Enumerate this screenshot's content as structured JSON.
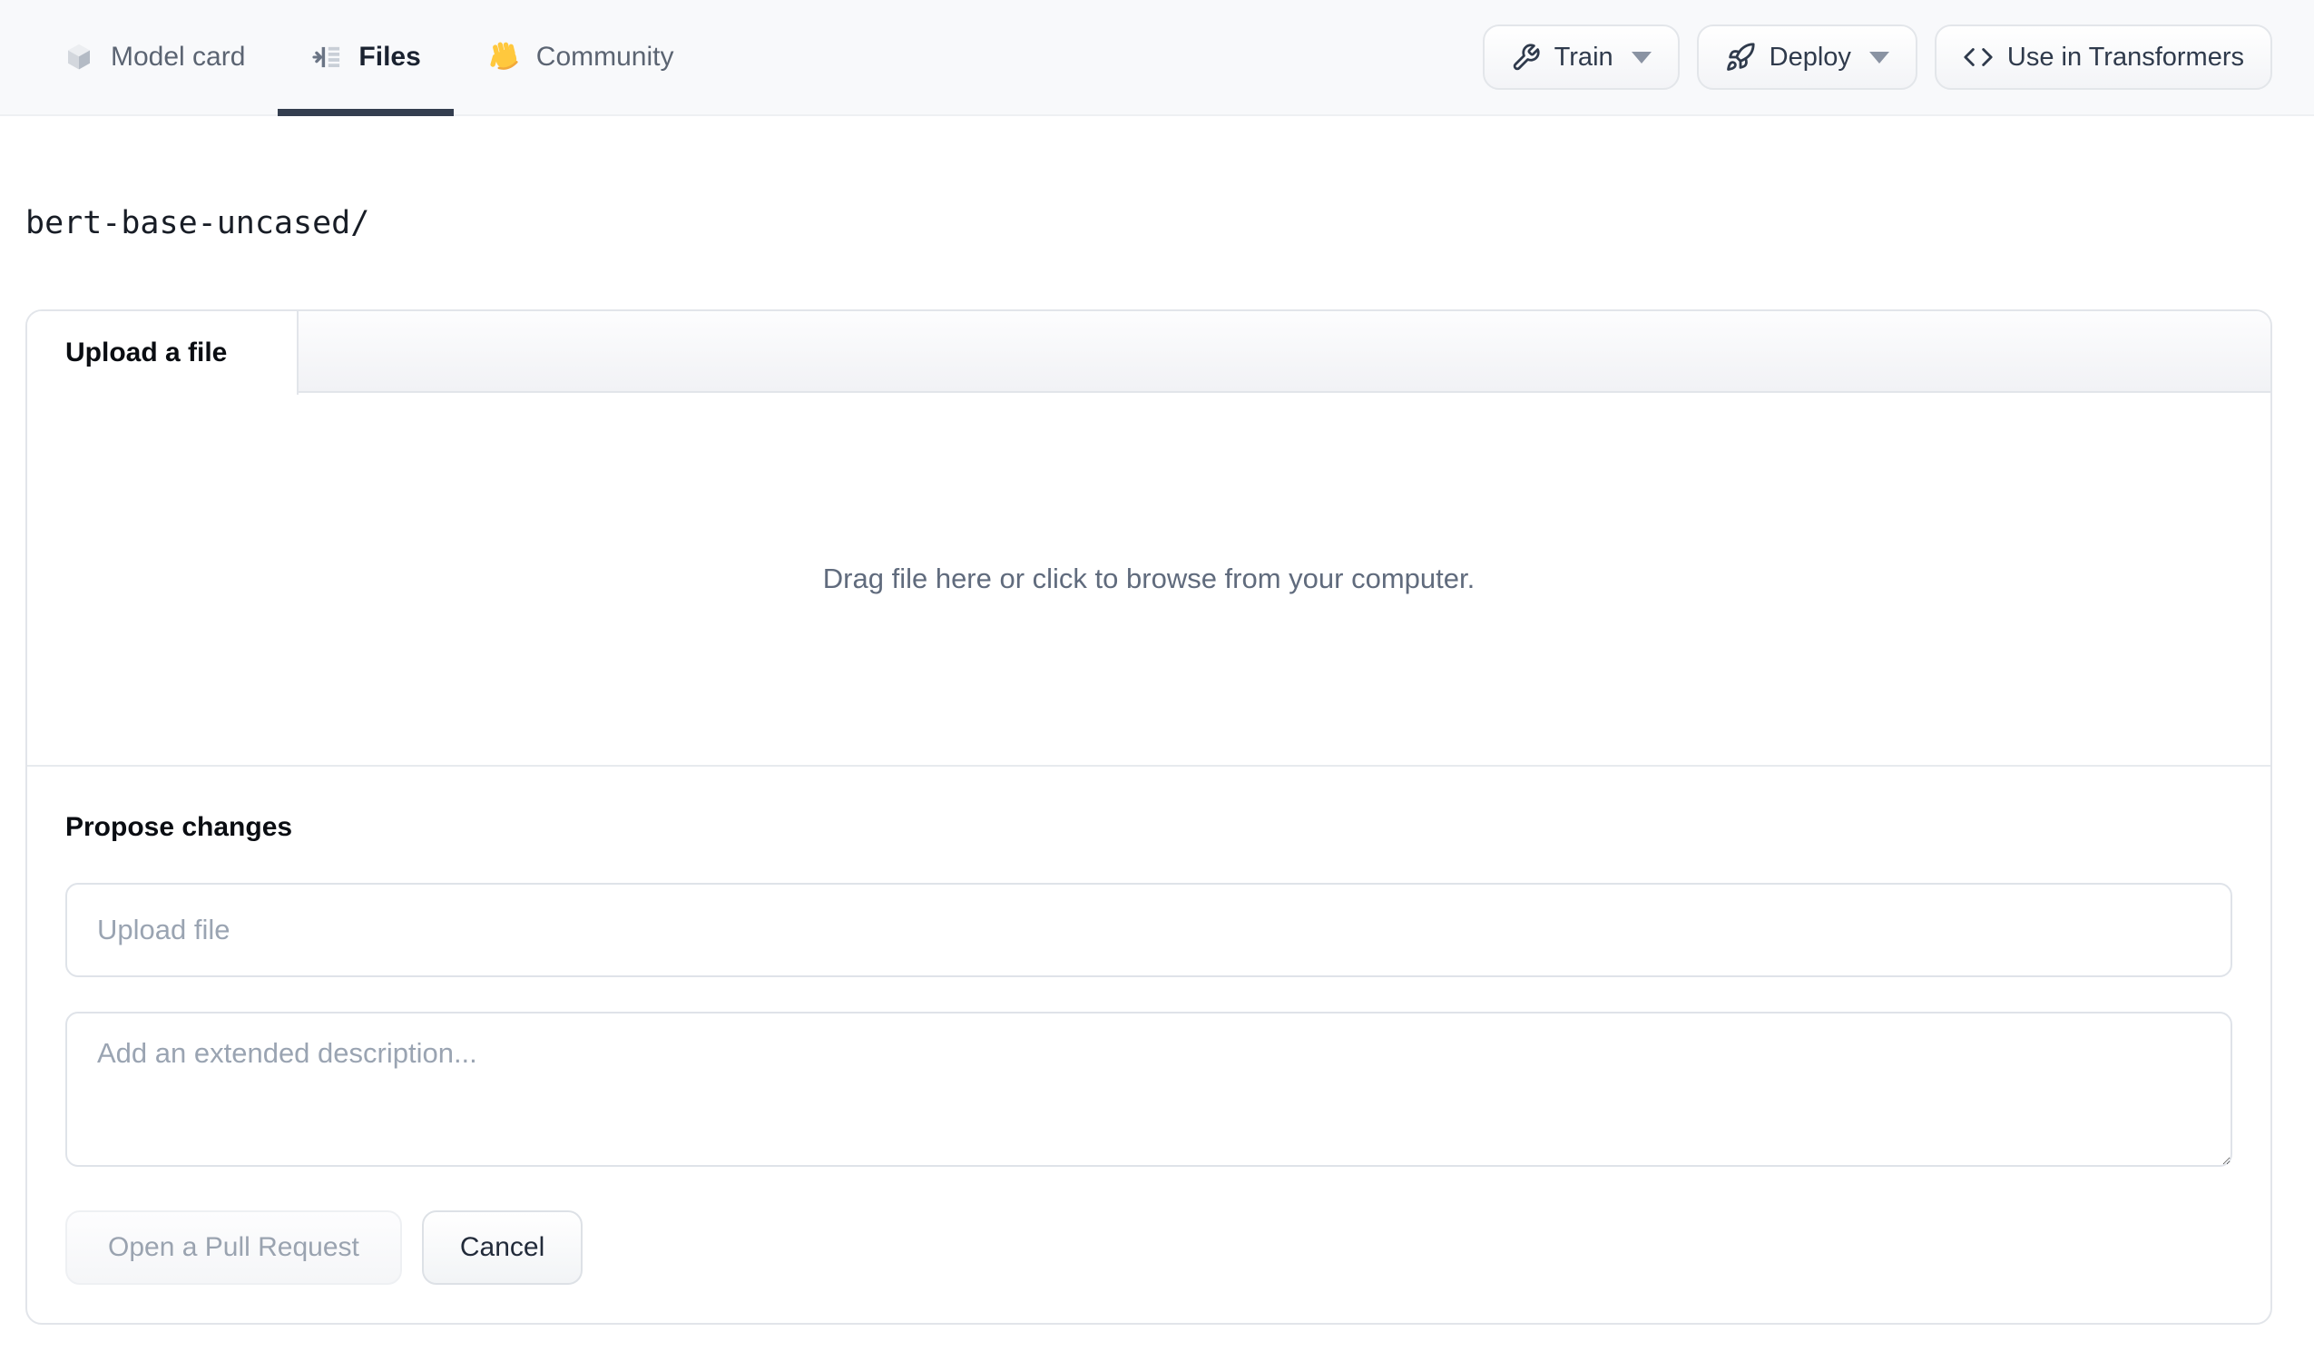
{
  "header": {
    "tabs": [
      {
        "label": "Model card",
        "icon": "cube-icon",
        "active": false
      },
      {
        "label": "Files",
        "icon": "files-tree-icon",
        "active": true
      },
      {
        "label": "Community",
        "icon": "waving-hand-icon",
        "active": false
      }
    ],
    "actions": [
      {
        "label": "Train",
        "icon": "wrench-icon",
        "has_dropdown": true
      },
      {
        "label": "Deploy",
        "icon": "rocket-icon",
        "has_dropdown": true
      },
      {
        "label": "Use in Transformers",
        "icon": "code-icon",
        "has_dropdown": false
      }
    ]
  },
  "breadcrumb": {
    "path": "bert-base-uncased/"
  },
  "upload_card": {
    "tab_label": "Upload a file",
    "dropzone_text": "Drag file here or click to browse from your computer.",
    "propose": {
      "heading": "Propose changes",
      "filename_placeholder": "Upload file",
      "filename_value": "",
      "description_placeholder": "Add an extended description...",
      "description_value": "",
      "primary_label": "Open a Pull Request",
      "cancel_label": "Cancel"
    }
  },
  "colors": {
    "header_bg": "#f8f9fb",
    "active_tab_underline": "#343e4f",
    "card_border": "#e2e5ea",
    "muted_text": "#9aa4b2",
    "body_text": "#1a2230",
    "wave_yellow": "#ffc83d"
  }
}
